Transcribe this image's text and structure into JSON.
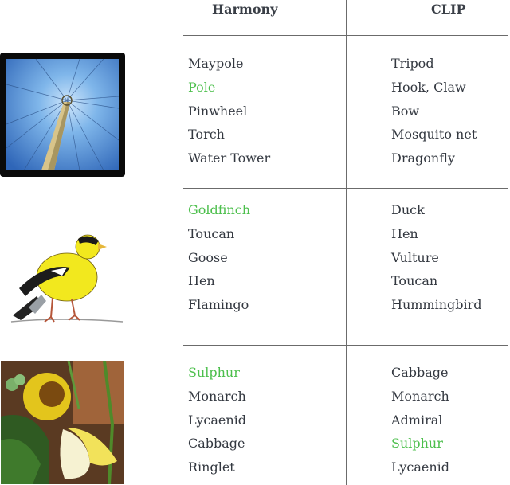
{
  "header": {
    "harmony_label": "Harmony",
    "clip_label": "CLIP"
  },
  "colors": {
    "match": "#4cbf4c",
    "text": "#333840",
    "rule": "#6b6b6b"
  },
  "rows": [
    {
      "image": "maypole-photo",
      "harmony": [
        {
          "label": "Maypole",
          "correct": false
        },
        {
          "label": "Pole",
          "correct": true
        },
        {
          "label": "Pinwheel",
          "correct": false
        },
        {
          "label": "Torch",
          "correct": false
        },
        {
          "label": "Water Tower",
          "correct": false
        }
      ],
      "clip": [
        {
          "label": "Tripod",
          "correct": false
        },
        {
          "label": "Hook, Claw",
          "correct": false
        },
        {
          "label": "Bow",
          "correct": false
        },
        {
          "label": "Mosquito net",
          "correct": false
        },
        {
          "label": "Dragonfly",
          "correct": false
        }
      ]
    },
    {
      "image": "goldfinch-drawing",
      "harmony": [
        {
          "label": "Goldfinch",
          "correct": true
        },
        {
          "label": "Toucan",
          "correct": false
        },
        {
          "label": "Goose",
          "correct": false
        },
        {
          "label": "Hen",
          "correct": false
        },
        {
          "label": "Flamingo",
          "correct": false
        }
      ],
      "clip": [
        {
          "label": "Duck",
          "correct": false
        },
        {
          "label": "Hen",
          "correct": false
        },
        {
          "label": "Vulture",
          "correct": false
        },
        {
          "label": "Toucan",
          "correct": false
        },
        {
          "label": "Hummingbird",
          "correct": false
        }
      ]
    },
    {
      "image": "sulphur-butterfly-photo",
      "harmony": [
        {
          "label": "Sulphur",
          "correct": true
        },
        {
          "label": "Monarch",
          "correct": false
        },
        {
          "label": "Lycaenid",
          "correct": false
        },
        {
          "label": "Cabbage",
          "correct": false
        },
        {
          "label": "Ringlet",
          "correct": false
        }
      ],
      "clip": [
        {
          "label": "Cabbage",
          "correct": false
        },
        {
          "label": "Monarch",
          "correct": false
        },
        {
          "label": "Admiral",
          "correct": false
        },
        {
          "label": "Sulphur",
          "correct": true
        },
        {
          "label": "Lycaenid",
          "correct": false
        }
      ]
    }
  ]
}
